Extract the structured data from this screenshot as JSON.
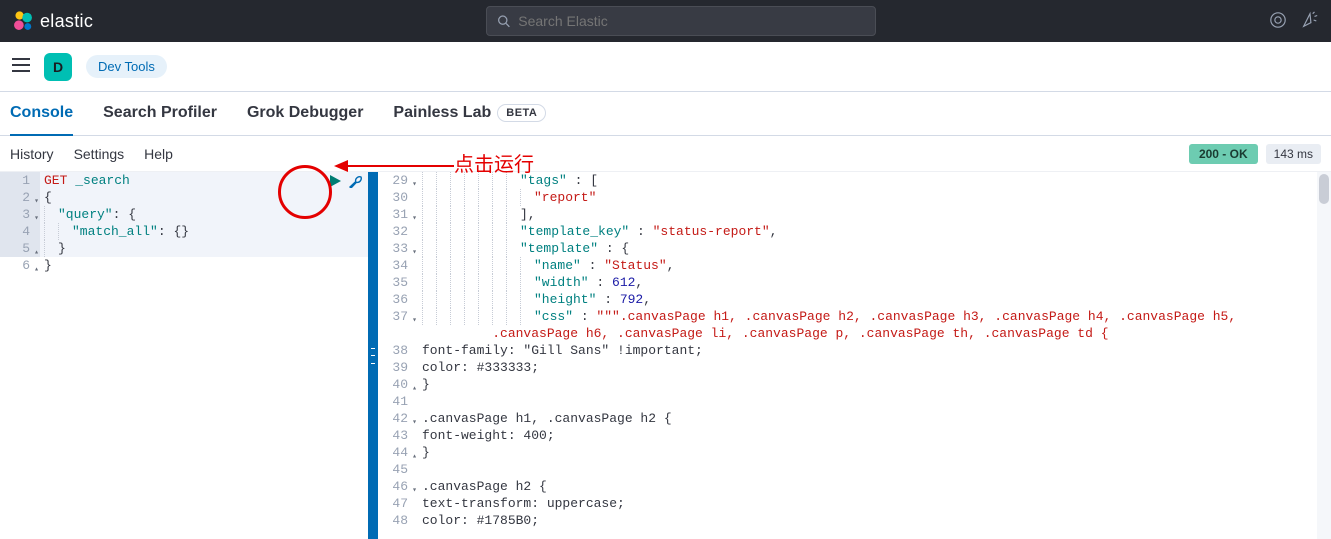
{
  "header": {
    "brand": "elastic",
    "search_placeholder": "Search Elastic"
  },
  "subheader": {
    "avatar_letter": "D",
    "devtools_label": "Dev Tools"
  },
  "tabs": {
    "console": "Console",
    "profiler": "Search Profiler",
    "grok": "Grok Debugger",
    "painless": "Painless Lab",
    "beta": "BETA"
  },
  "toolbar": {
    "history": "History",
    "settings": "Settings",
    "help": "Help",
    "status": "200 - OK",
    "time": "143 ms"
  },
  "annotation": {
    "text": "点击运行"
  },
  "request": {
    "lines": [
      {
        "num": "1",
        "fold": "",
        "html": "<span class='tok-method'>GET</span> <span class='tok-url'>_search</span>",
        "hl": true
      },
      {
        "num": "2",
        "fold": "▾",
        "html": "<span class='tok-brace'>{</span>",
        "hl": true
      },
      {
        "num": "3",
        "fold": "▾",
        "html": "<span class='guide'></span><span class='tok-key'>\"query\"</span>: <span class='tok-brace'>{</span>",
        "hl": true
      },
      {
        "num": "4",
        "fold": "",
        "html": "<span class='guide'></span><span class='guide'></span><span class='tok-key'>\"match_all\"</span>: <span class='tok-brace'>{}</span>",
        "hl": true
      },
      {
        "num": "5",
        "fold": "▴",
        "html": "<span class='guide'></span><span class='tok-brace'>}</span>",
        "hl": true
      },
      {
        "num": "6",
        "fold": "▴",
        "html": "<span class='tok-brace'>}</span>",
        "hl": false
      }
    ]
  },
  "response": {
    "lines": [
      {
        "num": "29",
        "fold": "▾",
        "html": "<span class='guide'></span><span class='guide'></span><span class='guide'></span><span class='guide'></span><span class='guide'></span><span class='guide'></span><span class='guide'></span><span class='tok-key'>\"tags\"</span> : <span class='tok-brace'>[</span>"
      },
      {
        "num": "30",
        "fold": "",
        "html": "<span class='guide'></span><span class='guide'></span><span class='guide'></span><span class='guide'></span><span class='guide'></span><span class='guide'></span><span class='guide'></span><span class='guide'></span><span class='tok-str'>\"report\"</span>"
      },
      {
        "num": "31",
        "fold": "▾",
        "html": "<span class='guide'></span><span class='guide'></span><span class='guide'></span><span class='guide'></span><span class='guide'></span><span class='guide'></span><span class='guide'></span><span class='tok-brace'>],</span>"
      },
      {
        "num": "32",
        "fold": "",
        "html": "<span class='guide'></span><span class='guide'></span><span class='guide'></span><span class='guide'></span><span class='guide'></span><span class='guide'></span><span class='guide'></span><span class='tok-key'>\"template_key\"</span> : <span class='tok-str'>\"status-report\"</span><span class='tok-brace'>,</span>"
      },
      {
        "num": "33",
        "fold": "▾",
        "html": "<span class='guide'></span><span class='guide'></span><span class='guide'></span><span class='guide'></span><span class='guide'></span><span class='guide'></span><span class='guide'></span><span class='tok-key'>\"template\"</span> : <span class='tok-brace'>{</span>"
      },
      {
        "num": "34",
        "fold": "",
        "html": "<span class='guide'></span><span class='guide'></span><span class='guide'></span><span class='guide'></span><span class='guide'></span><span class='guide'></span><span class='guide'></span><span class='guide'></span><span class='tok-key'>\"name\"</span> : <span class='tok-str'>\"Status\"</span><span class='tok-brace'>,</span>"
      },
      {
        "num": "35",
        "fold": "",
        "html": "<span class='guide'></span><span class='guide'></span><span class='guide'></span><span class='guide'></span><span class='guide'></span><span class='guide'></span><span class='guide'></span><span class='guide'></span><span class='tok-key'>\"width\"</span> : <span class='tok-num'>612</span><span class='tok-brace'>,</span>"
      },
      {
        "num": "36",
        "fold": "",
        "html": "<span class='guide'></span><span class='guide'></span><span class='guide'></span><span class='guide'></span><span class='guide'></span><span class='guide'></span><span class='guide'></span><span class='guide'></span><span class='tok-key'>\"height\"</span> : <span class='tok-num'>792</span><span class='tok-brace'>,</span>"
      },
      {
        "num": "37",
        "fold": "▾",
        "html": "<span class='guide'></span><span class='guide'></span><span class='guide'></span><span class='guide'></span><span class='guide'></span><span class='guide'></span><span class='guide'></span><span class='guide'></span><span class='tok-key'>\"css\"</span> : <span class='tok-str'>\"\"\".canvasPage h1, .canvasPage h2, .canvasPage h3, .canvasPage h4, .canvasPage h5,\n         .canvasPage h6, .canvasPage li, .canvasPage p, .canvasPage th, .canvasPage td {</span>"
      },
      {
        "num": "38",
        "fold": "",
        "html": "<span class='tok-plain'>font-family: \"Gill Sans\" !important;</span>"
      },
      {
        "num": "39",
        "fold": "",
        "html": "<span class='tok-plain'>color: #333333;</span>"
      },
      {
        "num": "40",
        "fold": "▴",
        "html": "<span class='tok-plain'>}</span>"
      },
      {
        "num": "41",
        "fold": "",
        "html": ""
      },
      {
        "num": "42",
        "fold": "▾",
        "html": "<span class='tok-plain'>.canvasPage h1, .canvasPage h2 {</span>"
      },
      {
        "num": "43",
        "fold": "",
        "html": "<span class='tok-plain'>font-weight: 400;</span>"
      },
      {
        "num": "44",
        "fold": "▴",
        "html": "<span class='tok-plain'>}</span>"
      },
      {
        "num": "45",
        "fold": "",
        "html": ""
      },
      {
        "num": "46",
        "fold": "▾",
        "html": "<span class='tok-plain'>.canvasPage h2 {</span>"
      },
      {
        "num": "47",
        "fold": "",
        "html": "<span class='tok-plain'>text-transform: uppercase;</span>"
      },
      {
        "num": "48",
        "fold": "",
        "html": "<span class='tok-plain'>color: #1785B0;</span>"
      }
    ]
  }
}
